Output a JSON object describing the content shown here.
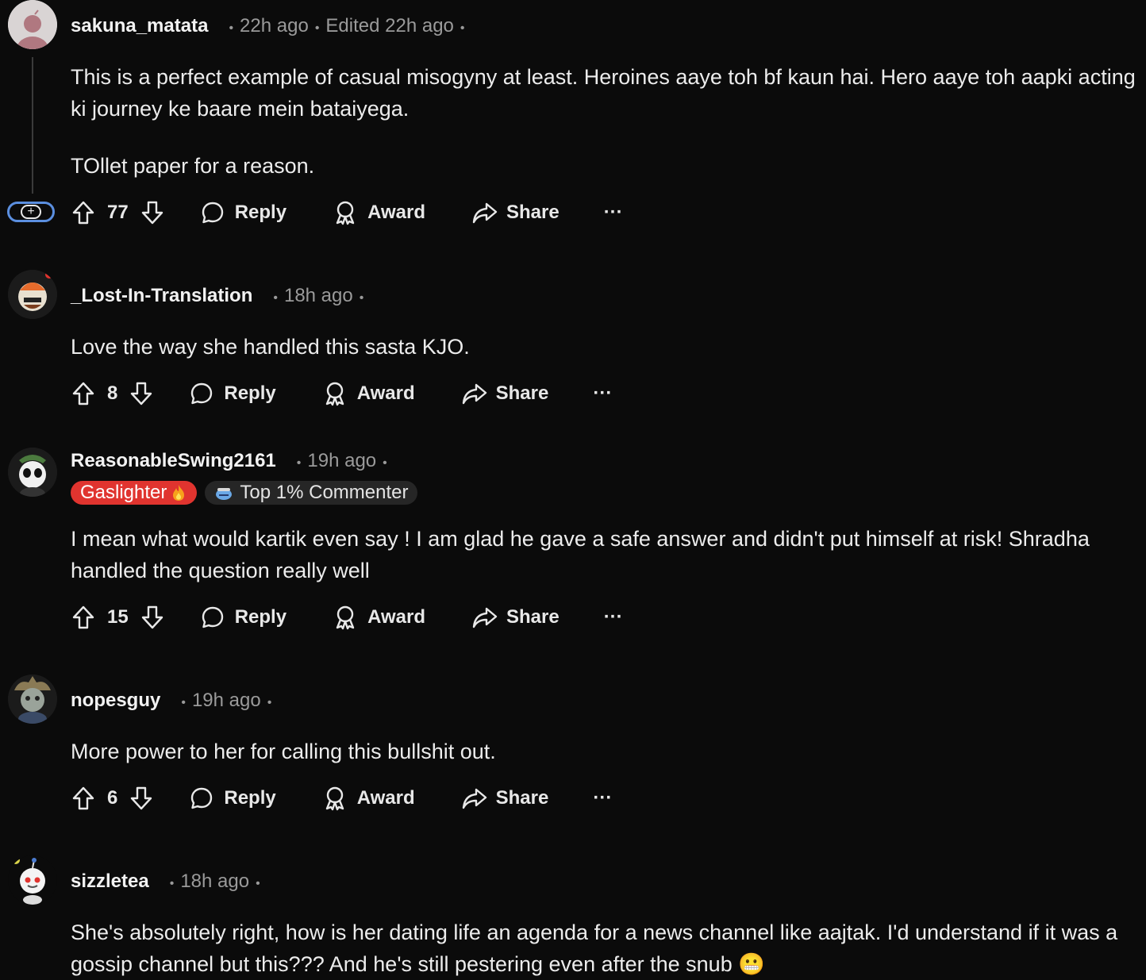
{
  "actions": {
    "reply": "Reply",
    "award": "Award",
    "share": "Share",
    "more": "···"
  },
  "comments": [
    {
      "username": "sakuna_matata",
      "time": "22h ago",
      "edited": "Edited 22h ago",
      "body": [
        "This is a perfect example of casual misogyny at least. Heroines aaye toh bf kaun hai. Hero aaye toh aapki acting ki journey ke baare mein bataiyega.",
        "TOllet paper for a reason."
      ],
      "votes": "77"
    },
    {
      "username": "_Lost-In-Translation",
      "time": "18h ago",
      "body": [
        "Love the way she handled this sasta KJO."
      ],
      "votes": "8"
    },
    {
      "username": "ReasonableSwing2161",
      "time": "19h ago",
      "flairs": [
        {
          "text": "Gaslighter",
          "icon": "fire-icon",
          "color": "#e0342f"
        },
        {
          "text": "Top 1% Commenter",
          "icon": "top-commenter-icon"
        }
      ],
      "body": [
        "I mean what would kartik even say ! I am glad he gave a safe answer and didn't put himself at risk! Shradha handled the question really well"
      ],
      "votes": "15"
    },
    {
      "username": "nopesguy",
      "time": "19h ago",
      "body": [
        "More power to her for calling this bullshit out."
      ],
      "votes": "6"
    },
    {
      "username": "sizzletea",
      "time": "18h ago",
      "body": [
        "She's absolutely right, how is her dating life an agenda for a news channel like aajtak. I'd understand if it was a gossip channel but this??? And he's still pestering even after the snub 😬"
      ]
    }
  ]
}
